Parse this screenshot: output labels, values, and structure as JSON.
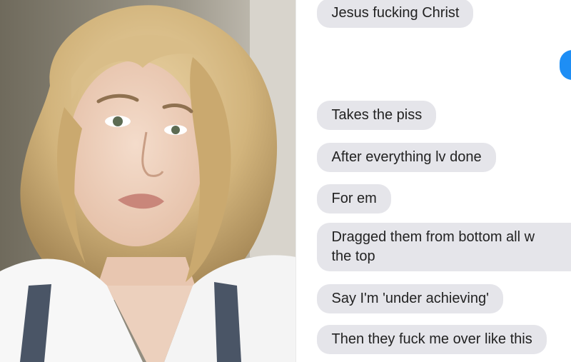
{
  "photo": {
    "description_icon": "portrait-photo"
  },
  "messages": [
    {
      "text": "Jesus fucking Christ"
    },
    {
      "text": "Takes the piss"
    },
    {
      "text": "After everything lv done"
    },
    {
      "text": "For em"
    },
    {
      "text": "Dragged them from bottom all w"
    },
    {
      "text": "the top"
    },
    {
      "text": "Say I'm 'under achieving'"
    },
    {
      "text": "Then they fuck me over like this"
    }
  ],
  "colors": {
    "received_bubble": "#e5e5ea",
    "sent_bubble": "#1e8ef5"
  }
}
